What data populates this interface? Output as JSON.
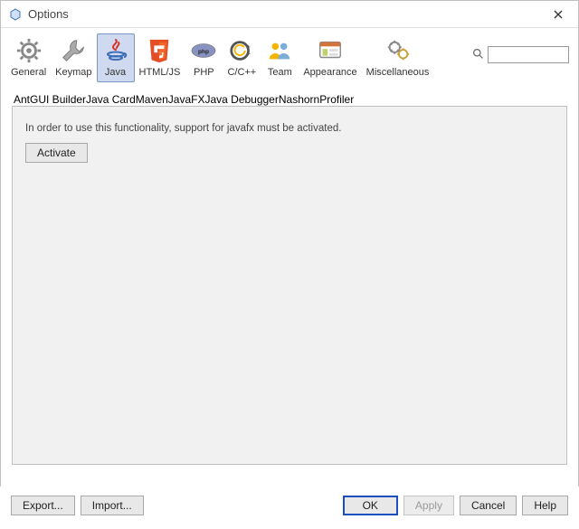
{
  "window": {
    "title": "Options"
  },
  "categories": [
    {
      "id": "general",
      "label": "General",
      "icon": "gear"
    },
    {
      "id": "keymap",
      "label": "Keymap",
      "icon": "keyboard"
    },
    {
      "id": "java",
      "label": "Java",
      "icon": "java",
      "selected": true
    },
    {
      "id": "htmljs",
      "label": "HTML/JS",
      "icon": "html5"
    },
    {
      "id": "php",
      "label": "PHP",
      "icon": "php"
    },
    {
      "id": "cpp",
      "label": "C/C++",
      "icon": "cpp"
    },
    {
      "id": "team",
      "label": "Team",
      "icon": "team"
    },
    {
      "id": "appearance",
      "label": "Appearance",
      "icon": "appearance"
    },
    {
      "id": "miscellaneous",
      "label": "Miscellaneous",
      "icon": "misc"
    }
  ],
  "search": {
    "placeholder": ""
  },
  "subtabs": [
    {
      "id": "ant",
      "label": "Ant"
    },
    {
      "id": "guibuilder",
      "label": "GUI Builder"
    },
    {
      "id": "javacard",
      "label": "Java Card"
    },
    {
      "id": "maven",
      "label": "Maven"
    },
    {
      "id": "javafx",
      "label": "JavaFX",
      "active": true
    },
    {
      "id": "javadebugger",
      "label": "Java Debugger"
    },
    {
      "id": "nashorn",
      "label": "Nashorn"
    },
    {
      "id": "profiler",
      "label": "Profiler"
    }
  ],
  "panel": {
    "message": "In order to use this functionality, support for javafx must be activated.",
    "activate_label": "Activate"
  },
  "footer": {
    "export_label": "Export...",
    "import_label": "Import...",
    "ok_label": "OK",
    "apply_label": "Apply",
    "cancel_label": "Cancel",
    "help_label": "Help"
  }
}
